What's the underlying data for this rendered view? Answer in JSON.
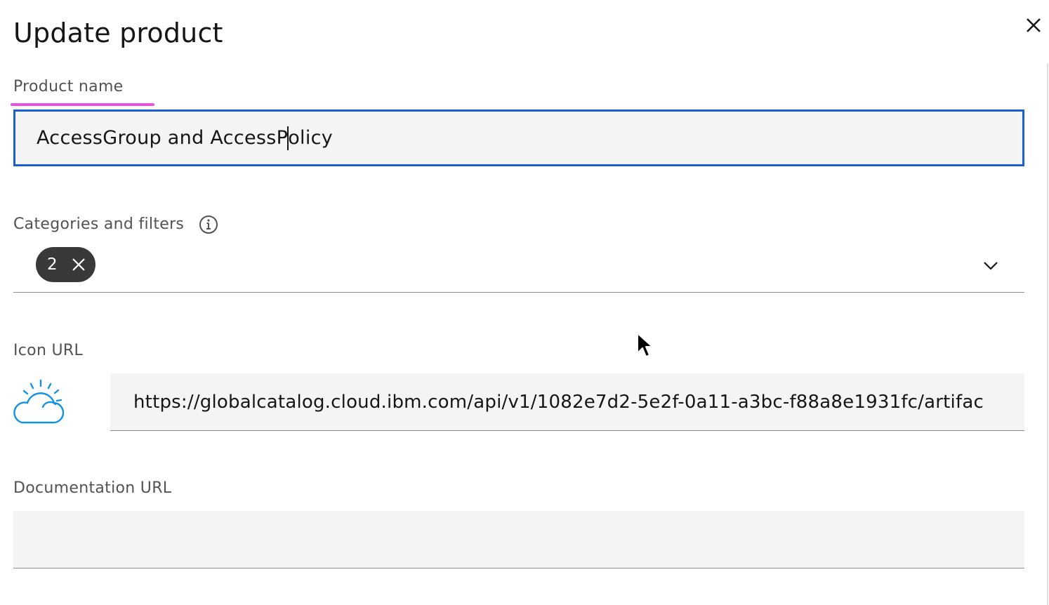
{
  "dialog": {
    "title": "Update product",
    "close_icon": "close-icon"
  },
  "product_name": {
    "label": "Product name",
    "value_before_caret": "AccessGroup and AccessP",
    "value_after_caret": "olicy",
    "focused": true,
    "label_underline_color": "#ee4ee3",
    "focus_border_color": "#1b5fd1"
  },
  "categories": {
    "label": "Categories and filters",
    "info_icon": "info-icon",
    "selected_count": "2",
    "tag_clear_icon": "close-icon",
    "dropdown_icon": "chevron-down-icon"
  },
  "icon_url": {
    "label": "Icon URL",
    "preview_icon": "ibm-cloud-icon",
    "value": "https://globalcatalog.cloud.ibm.com/api/v1/1082e7d2-5e2f-0a11-a3bc-f88a8e1931fc/artifac"
  },
  "documentation_url": {
    "label": "Documentation URL",
    "value": ""
  },
  "colors": {
    "field_background": "#f4f4f4",
    "tag_background": "#393939",
    "cloud_icon": "#1192e8"
  }
}
